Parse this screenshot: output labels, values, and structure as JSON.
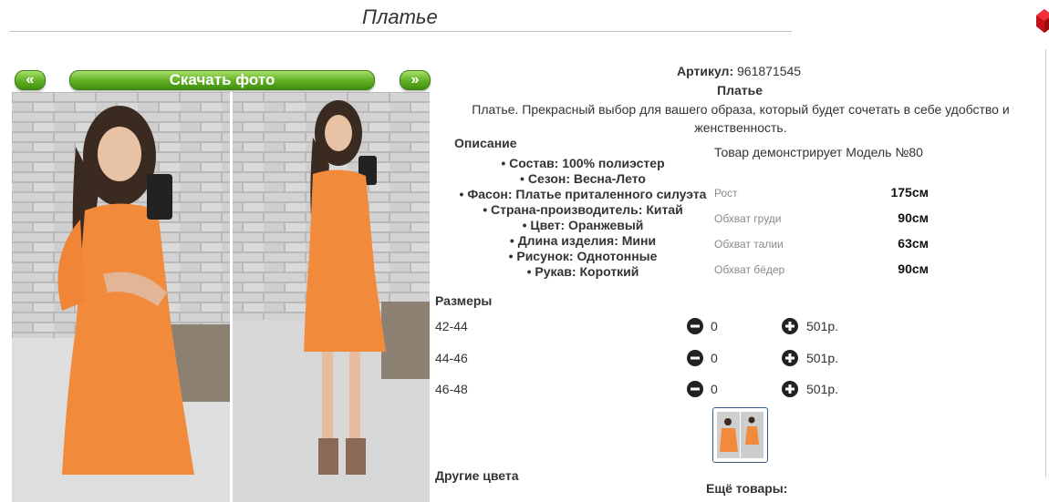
{
  "page": {
    "title": "Платье"
  },
  "gallery": {
    "prev_label": "«",
    "download_label": "Скачать фото",
    "next_label": "»"
  },
  "product": {
    "article_label": "Артикул:",
    "article_value": "961871545",
    "name": "Платье",
    "description": "Платье. Прекрасный выбор для вашего образа, который будет сочетать в себе удобство и женственность.",
    "description_heading": "Описание",
    "features": [
      "Состав: 100% полиэстер",
      "Сезон: Весна-Лето",
      "Фасон: Платье приталенного силуэта",
      "Страна-производитель: Китай",
      "Цвет: Оранжевый",
      "Длина изделия: Мини",
      "Рисунок: Однотонные",
      "Рукав: Короткий"
    ]
  },
  "model": {
    "caption": "Товар демонстрирует Модель №80",
    "measurements": [
      {
        "label": "Рост",
        "value": "175см"
      },
      {
        "label": "Обхват груди",
        "value": "90см"
      },
      {
        "label": "Обхват талии",
        "value": "63см"
      },
      {
        "label": "Обхват бёдер",
        "value": "90см"
      }
    ]
  },
  "sizes": {
    "heading": "Размеры",
    "rows": [
      {
        "size": "42-44",
        "qty": "0",
        "price": "501р."
      },
      {
        "size": "44-46",
        "qty": "0",
        "price": "501р."
      },
      {
        "size": "46-48",
        "qty": "0",
        "price": "501р."
      }
    ]
  },
  "footer": {
    "other_colors": "Другие цвета",
    "more_products": "Ещё товары:"
  },
  "colors": {
    "accent_green": "#5fae22",
    "dress_orange": "#f28a3c",
    "brand_red": "#d8121a"
  },
  "icons": {
    "corner": "red-cube-icon",
    "minus": "minus-circle-icon",
    "plus": "plus-circle-icon"
  }
}
